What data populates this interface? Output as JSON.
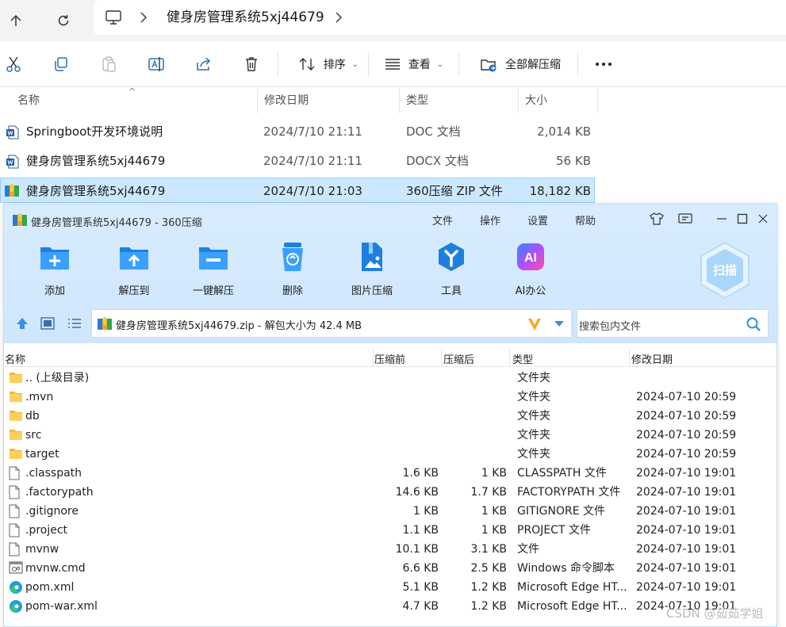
{
  "explorer": {
    "breadcrumb_title": "健身房管理系统5xj44679",
    "commands": {
      "sort_label": "排序",
      "view_label": "查看",
      "extract_all_label": "全部解压缩"
    },
    "columns": [
      "名称",
      "修改日期",
      "类型",
      "大小"
    ],
    "files": [
      {
        "name": "Springboot开发环境说明",
        "date": "2024/7/10 21:11",
        "type": "DOC 文档",
        "size": "2,014 KB"
      },
      {
        "name": "健身房管理系统5xj44679",
        "date": "2024/7/10 21:11",
        "type": "DOCX 文档",
        "size": "56 KB"
      },
      {
        "name": "健身房管理系统5xj44679",
        "date": "2024/7/10 21:03",
        "type": "360压缩 ZIP 文件",
        "size": "18,182 KB"
      }
    ]
  },
  "zip_window": {
    "title": "健身房管理系统5xj44679 - 360压缩",
    "menus": [
      "文件",
      "操作",
      "设置",
      "帮助"
    ],
    "tools": [
      "添加",
      "解压到",
      "一键解压",
      "删除",
      "图片压缩",
      "工具",
      "AI办公"
    ],
    "scan_label": "扫描",
    "ai_icon_text": "AI",
    "path": "健身房管理系统5xj44679.zip - 解包大小为 42.4 MB",
    "search_placeholder": "搜索包内文件",
    "columns": [
      "名称",
      "压缩前",
      "压缩后",
      "类型",
      "修改日期"
    ],
    "rows": [
      {
        "name": ".. (上级目录)",
        "before": "",
        "after": "",
        "type": "文件夹",
        "date": "",
        "icon": "folder"
      },
      {
        "name": ".mvn",
        "before": "",
        "after": "",
        "type": "文件夹",
        "date": "2024-07-10 20:59",
        "icon": "folder"
      },
      {
        "name": "db",
        "before": "",
        "after": "",
        "type": "文件夹",
        "date": "2024-07-10 20:59",
        "icon": "folder"
      },
      {
        "name": "src",
        "before": "",
        "after": "",
        "type": "文件夹",
        "date": "2024-07-10 20:59",
        "icon": "folder"
      },
      {
        "name": "target",
        "before": "",
        "after": "",
        "type": "文件夹",
        "date": "2024-07-10 20:59",
        "icon": "folder"
      },
      {
        "name": ".classpath",
        "before": "1.6 KB",
        "after": "1 KB",
        "type": "CLASSPATH 文件",
        "date": "2024-07-10 19:01",
        "icon": "file"
      },
      {
        "name": ".factorypath",
        "before": "14.6 KB",
        "after": "1.7 KB",
        "type": "FACTORYPATH 文件",
        "date": "2024-07-10 19:01",
        "icon": "file"
      },
      {
        "name": ".gitignore",
        "before": "1 KB",
        "after": "1 KB",
        "type": "GITIGNORE 文件",
        "date": "2024-07-10 19:01",
        "icon": "file"
      },
      {
        "name": ".project",
        "before": "1.1 KB",
        "after": "1 KB",
        "type": "PROJECT 文件",
        "date": "2024-07-10 19:01",
        "icon": "file"
      },
      {
        "name": "mvnw",
        "before": "10.1 KB",
        "after": "3.1 KB",
        "type": "文件",
        "date": "2024-07-10 19:01",
        "icon": "file"
      },
      {
        "name": "mvnw.cmd",
        "before": "6.6 KB",
        "after": "2.5 KB",
        "type": "Windows 命令脚本",
        "date": "2024-07-10 19:01",
        "icon": "cmd"
      },
      {
        "name": "pom.xml",
        "before": "5.1 KB",
        "after": "1.2 KB",
        "type": "Microsoft Edge HT...",
        "date": "2024-07-10 19:01",
        "icon": "edge"
      },
      {
        "name": "pom-war.xml",
        "before": "4.7 KB",
        "after": "1.2 KB",
        "type": "Microsoft Edge HT...",
        "date": "2024-07-10 19:01",
        "icon": "edge"
      }
    ]
  },
  "watermark": "CSDN @茹茹学姐"
}
